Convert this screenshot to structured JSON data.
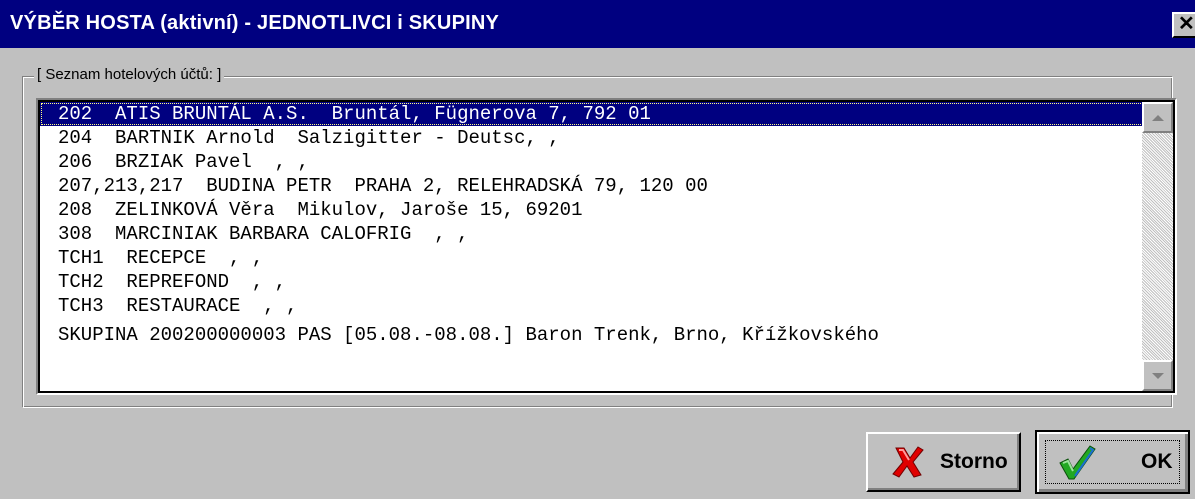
{
  "window": {
    "title": "VÝBĚR HOSTA (aktivní) - JEDNOTLIVCI i SKUPINY",
    "close_glyph": "✕"
  },
  "group": {
    "label": "[ Seznam hotelových účtů: ]"
  },
  "list": {
    "selected_index": 0,
    "items": [
      "202  ATIS BRUNTÁL A.S.  Bruntál, Fügnerova 7, 792 01",
      "204  BARTNIK Arnold  Salzigitter - Deutsc, ,",
      "206  BRZIAK Pavel  , ,",
      "207,213,217  BUDINA PETR  PRAHA 2, RELEHRADSKÁ 79, 120 00",
      "208  ZELINKOVÁ Věra  Mikulov, Jaroše 15, 69201",
      "308  MARCINIAK BARBARA CALOFRIG  , ,",
      "TCH1  RECEPCE  , ,",
      "TCH2  REPREFOND  , ,",
      "TCH3  RESTAURACE  , ,",
      "SKUPINA 200200000003 PAS [05.08.-08.08.] Baron Trenk, Brno, Křížkovského"
    ]
  },
  "buttons": {
    "cancel_label": "Storno",
    "ok_label": "OK",
    "cancel_icon": "red-x-icon",
    "ok_icon": "green-checkmark-icon"
  },
  "colors": {
    "titlebar": "#000080",
    "face": "#c0c0c0",
    "selection": "#000080"
  }
}
